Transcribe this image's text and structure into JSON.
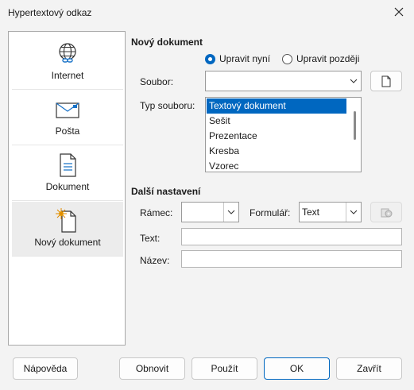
{
  "window": {
    "title": "Hypertextový odkaz",
    "close_icon": "close-icon"
  },
  "sidebar": {
    "items": [
      {
        "label": "Internet",
        "icon": "globe-link-icon"
      },
      {
        "label": "Pošta",
        "icon": "mail-envelope-icon"
      },
      {
        "label": "Dokument",
        "icon": "document-icon"
      },
      {
        "label": "Nový dokument",
        "icon": "new-document-icon",
        "active": true
      }
    ]
  },
  "new_document": {
    "heading": "Nový dokument",
    "edit_now": "Upravit nyní",
    "edit_later": "Upravit později",
    "edit_mode_selected": "edit_now",
    "file_label": "Soubor:",
    "file_value": "",
    "file_type_label": "Typ souboru:",
    "file_types": [
      "Textový dokument",
      "Sešit",
      "Prezentace",
      "Kresba",
      "Vzorec"
    ],
    "file_type_selected": "Textový dokument"
  },
  "further": {
    "heading": "Další nastavení",
    "frame_label": "Rámec:",
    "frame_value": "",
    "form_label": "Formulář:",
    "form_value": "Text",
    "text_label": "Text:",
    "text_value": "",
    "name_label": "Název:",
    "name_value": ""
  },
  "buttons": {
    "help": "Nápověda",
    "reset": "Obnovit",
    "apply": "Použít",
    "ok": "OK",
    "close": "Zavřít"
  },
  "colors": {
    "accent": "#0067c0",
    "background": "#f3f3f3"
  }
}
